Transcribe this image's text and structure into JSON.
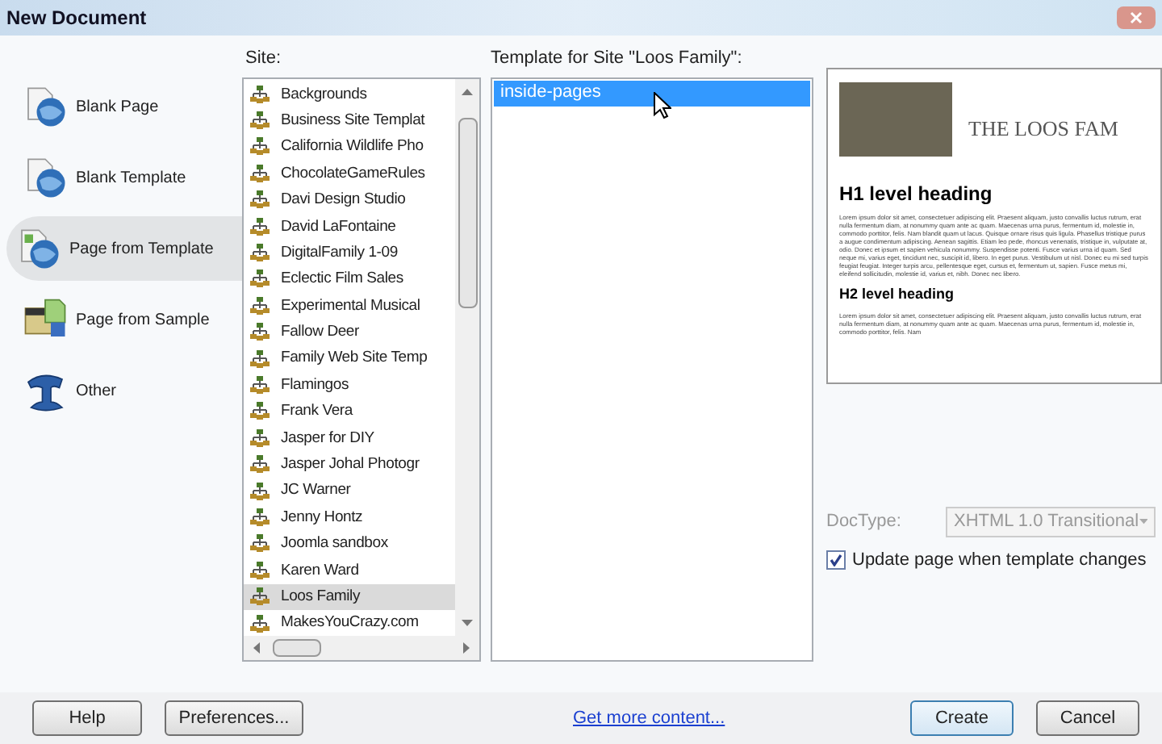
{
  "window": {
    "title": "New Document"
  },
  "categories": [
    {
      "label": "Blank Page",
      "kind": "blank-page",
      "selected": false
    },
    {
      "label": "Blank Template",
      "kind": "blank-template",
      "selected": false
    },
    {
      "label": "Page from Template",
      "kind": "template-page",
      "selected": true
    },
    {
      "label": "Page from Sample",
      "kind": "sample-page",
      "selected": false
    },
    {
      "label": "Other",
      "kind": "other",
      "selected": false
    }
  ],
  "site_list": {
    "label": "Site:",
    "items": [
      {
        "label": "Backgrounds",
        "selected": false
      },
      {
        "label": "Business Site Templat",
        "selected": false
      },
      {
        "label": "California Wildlife Pho",
        "selected": false
      },
      {
        "label": "ChocolateGameRules",
        "selected": false
      },
      {
        "label": "Davi Design Studio",
        "selected": false
      },
      {
        "label": "David LaFontaine",
        "selected": false
      },
      {
        "label": "DigitalFamily 1-09",
        "selected": false
      },
      {
        "label": "Eclectic Film Sales",
        "selected": false
      },
      {
        "label": "Experimental Musical",
        "selected": false
      },
      {
        "label": "Fallow Deer",
        "selected": false
      },
      {
        "label": "Family Web Site Temp",
        "selected": false
      },
      {
        "label": "Flamingos",
        "selected": false
      },
      {
        "label": "Frank Vera",
        "selected": false
      },
      {
        "label": "Jasper for DIY",
        "selected": false
      },
      {
        "label": "Jasper Johal Photogr",
        "selected": false
      },
      {
        "label": "JC Warner",
        "selected": false
      },
      {
        "label": "Jenny Hontz",
        "selected": false
      },
      {
        "label": "Joomla sandbox",
        "selected": false
      },
      {
        "label": "Karen Ward",
        "selected": false
      },
      {
        "label": "Loos Family",
        "selected": true
      },
      {
        "label": "MakesYouCrazy.com",
        "selected": false
      }
    ]
  },
  "template_list": {
    "label": "Template for Site \"Loos Family\":",
    "items": [
      {
        "label": "inside-pages",
        "selected": true
      }
    ]
  },
  "preview": {
    "site_title": "THE LOOS FAM",
    "h1": "H1 level heading",
    "p1": "Lorem ipsum dolor sit amet, consectetuer adipiscing elit. Praesent aliquam, justo convallis luctus rutrum, erat nulla fermentum diam, at nonummy quam ante ac quam. Maecenas urna purus, fermentum id, molestie in, commodo porttitor, felis. Nam blandit quam ut lacus. Quisque ornare risus quis ligula. Phasellus tristique purus a augue condimentum adipiscing. Aenean sagittis. Etiam leo pede, rhoncus venenatis, tristique in, vulputate at, odio. Donec et ipsum et sapien vehicula nonummy. Suspendisse potenti. Fusce varius urna id quam. Sed neque mi, varius eget, tincidunt nec, suscipit id, libero. In eget purus. Vestibulum ut nisl. Donec eu mi sed turpis feugiat feugiat. Integer turpis arcu, pellentesque eget, cursus et, fermentum ut, sapien. Fusce metus mi, eleifend sollicitudin, molestie id, varius et, nibh. Donec nec libero.",
    "h2": "H2 level heading",
    "p2": "Lorem ipsum dolor sit amet, consectetuer adipiscing elit. Praesent aliquam, justo convallis luctus rutrum, erat nulla fermentum diam, at nonummy quam ante ac quam. Maecenas urna purus, fermentum id, molestie in, commodo porttitor, felis. Nam"
  },
  "doctype": {
    "label": "DocType:",
    "value": "XHTML 1.0 Transitional",
    "disabled": true
  },
  "update_checkbox": {
    "label": "Update page when template changes",
    "checked": true
  },
  "footer": {
    "help": "Help",
    "preferences": "Preferences...",
    "link": "Get more content...",
    "create": "Create",
    "cancel": "Cancel"
  }
}
